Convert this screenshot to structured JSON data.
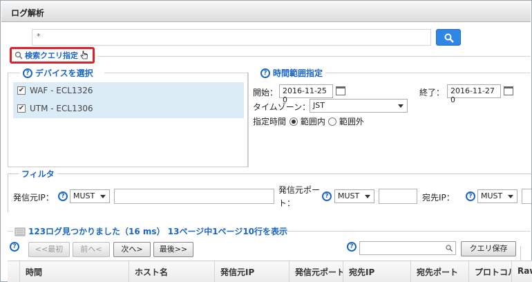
{
  "window": {
    "title": "ログ解析"
  },
  "search": {
    "query": "*"
  },
  "query_spec": {
    "label": "検索クエリ指定"
  },
  "devices": {
    "heading": "デバイスを選択",
    "items": [
      {
        "label": "WAF - ECL1326",
        "checked": true
      },
      {
        "label": "UTM - ECL1306",
        "checked": true
      }
    ]
  },
  "time_range": {
    "heading": "時間範囲指定",
    "start_label": "開始：",
    "start_value": "2016-11-25 0",
    "end_label": "終了：",
    "end_value": "2016-11-27 0",
    "timezone_label": "タイムゾーン：",
    "timezone_value": "JST",
    "mode_label": "指定時間",
    "mode_inside": "範囲内",
    "mode_outside": "範囲外",
    "mode_selected": "範囲内"
  },
  "filter": {
    "heading": "フィルタ",
    "src_ip_label": "発信元IP：",
    "src_ip_match": "MUST",
    "src_port_label_1": "発信元ポー",
    "src_port_label_2": "ト：",
    "src_port_match": "MUST",
    "dst_ip_label": "宛先IP：",
    "dst_ip_match": "MUST"
  },
  "results": {
    "summary": "123ログ見つかりました（16 ms） 13ページ中1ページ10行を表示",
    "btn_first": "<<最初",
    "btn_prev": "前へ<",
    "btn_next": "次へ>",
    "btn_last": "最後>>",
    "btn_save_query": "クエリ保存",
    "columns": [
      "時間",
      "ホスト名",
      "発信元IP",
      "発信元ポート",
      "宛先IP",
      "宛先ポート",
      "プロトコル",
      "Raw"
    ]
  },
  "colors": {
    "accent": "#1a66c4",
    "highlight": "#d9232a",
    "search_button": "#2f86e6",
    "device_list_bg": "#dcecf7"
  }
}
